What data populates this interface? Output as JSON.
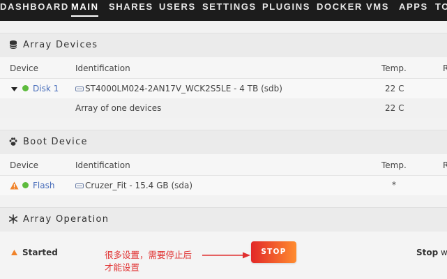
{
  "nav": {
    "items": [
      "DASHBOARD",
      "MAIN",
      "SHARES",
      "USERS",
      "SETTINGS",
      "PLUGINS",
      "DOCKER",
      "VMS",
      "APPS",
      "TO"
    ],
    "active": "MAIN"
  },
  "array_devices": {
    "title": "Array Devices",
    "columns": {
      "device": "Device",
      "identification": "Identification",
      "temp": "Temp.",
      "extra": "R"
    },
    "disk1": {
      "name": "Disk 1",
      "identification": "ST4000LM024-2AN17V_WCK2S5LE - 4 TB (sdb)",
      "temp": "22 C"
    },
    "summary": {
      "text": "Array of one devices",
      "temp": "22 C"
    }
  },
  "boot_device": {
    "title": "Boot Device",
    "columns": {
      "device": "Device",
      "identification": "Identification",
      "temp": "Temp.",
      "extra": "R"
    },
    "flash": {
      "name": "Flash",
      "identification": "Cruzer_Fit - 15.4 GB (sda)",
      "temp": "*"
    }
  },
  "array_operation": {
    "title": "Array Operation",
    "status": "Started",
    "stop_label": "STOP",
    "right_bold": "Stop",
    "right_rest": " wil",
    "annotation_line1": "很多设置，需要停止后",
    "annotation_line2": "才能设置"
  },
  "colors": {
    "accent_link": "#486dba",
    "status_green": "#5dbb3d",
    "warning_orange": "#f0832a",
    "stop_red": "#e22828",
    "annotation_red": "#e03030"
  }
}
